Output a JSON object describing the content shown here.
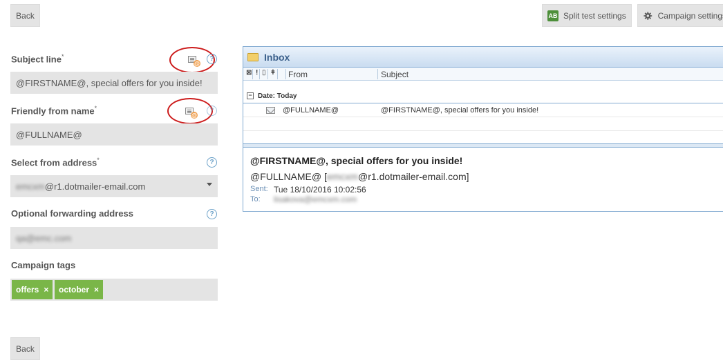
{
  "toolbar": {
    "back_top": "Back",
    "split_test": "Split test settings",
    "split_test_icon": "split-test-ab-icon",
    "campaign_settings": "Campaign settings",
    "campaign_settings_icon": "gear-icon",
    "back_bottom": "Back"
  },
  "form": {
    "subject_line": {
      "label": "Subject line",
      "required": "*",
      "value": "@FIRSTNAME@, special offers for you inside!",
      "help": "?"
    },
    "friendly_from": {
      "label": "Friendly from name",
      "required": "*",
      "value": "@FULLNAME@",
      "help": "?"
    },
    "from_address": {
      "label": "Select from address",
      "required": "*",
      "value_blurred": "emcxm",
      "value_domain": "@r1.dotmailer-email.com",
      "help": "?"
    },
    "forwarding": {
      "label": "Optional forwarding address",
      "value_blurred": "qa@emc.com",
      "help": "?"
    },
    "tags": {
      "label": "Campaign tags",
      "items": [
        {
          "text": "offers",
          "remove": "×"
        },
        {
          "text": "october",
          "remove": "×"
        }
      ]
    }
  },
  "preview": {
    "folder": "Inbox",
    "columns": {
      "from": "From",
      "subject": "Subject"
    },
    "group": "Date: Today",
    "message": {
      "from": "@FULLNAME@",
      "subject": "@FIRSTNAME@, special offers for you inside!"
    },
    "reading_pane": {
      "subject": "@FIRSTNAME@, special offers for you inside!",
      "from_name": "@FULLNAME@",
      "from_open": "[",
      "from_blurred": "emcxm",
      "from_domain": "@r1.dotmailer-email.com]",
      "sent_label": "Sent:",
      "sent_value": "Tue 18/10/2016 10:02:56",
      "to_label": "To:",
      "to_blurred": "lisakova@emcxm.com"
    }
  },
  "colors": {
    "ring": "#cc1a1a",
    "tag": "#7ab648",
    "field": "#e4e4e4",
    "help": "#6aa0c8"
  }
}
